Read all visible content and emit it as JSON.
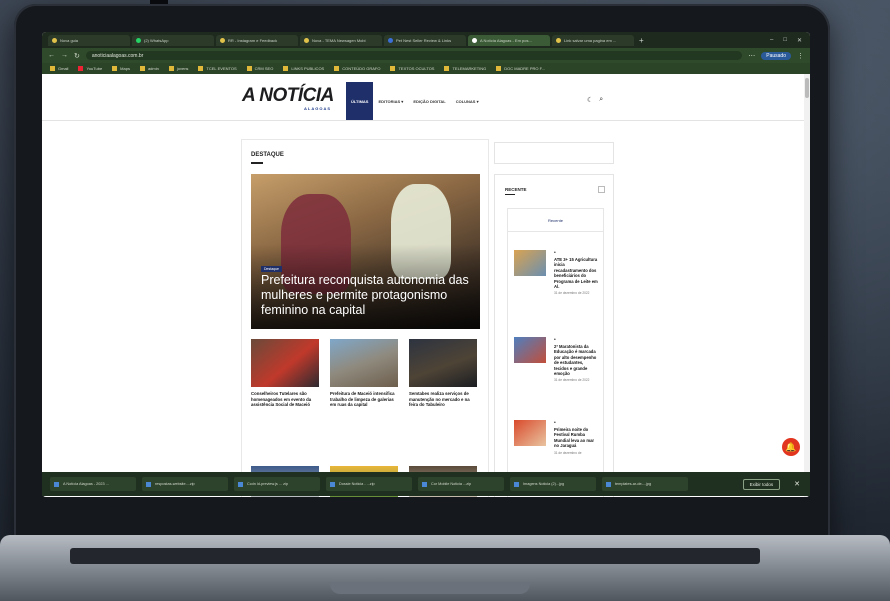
{
  "browser": {
    "tabs": [
      {
        "label": "Nova guia"
      },
      {
        "label": "(2) WhatsApp"
      },
      {
        "label": "RR - Instagram e Feedback"
      },
      {
        "label": "Nova - TEMA Newsagen Mobi"
      },
      {
        "label": "Pet Nest Seller Review & Links"
      },
      {
        "label": "A Notícia Alagoas - Em pos..."
      },
      {
        "label": "Link salvar uma pagina em ..."
      }
    ],
    "active_tab_index": 5,
    "url": "anoticiaalagoas.com.br",
    "profile_label": "Pausado",
    "bookmarks": [
      "Gmail",
      "YouTube",
      "Maps",
      "admin",
      "jovens",
      "TCEL EVENTOS",
      "CRM SEO",
      "LINKS PUBLICOS",
      "CONTEÚDO GRAFO",
      "TEXTOS OCULTOS",
      "TELEMARKETING",
      "DOC MADRE PRO F..."
    ]
  },
  "site": {
    "logo": "A NOTÍCIA",
    "logo_sub": "ALAGOAS",
    "menu": [
      "ÚLTIMAS",
      "EDITORIAS ▾",
      "EDIÇÃO DIGITAL",
      "COLUNAS ▾"
    ],
    "active_menu_index": 0,
    "header_icons": [
      "moon-icon",
      "search-icon"
    ]
  },
  "main": {
    "section_title": "DESTAQUE",
    "hero": {
      "badge": "Destaque",
      "title": "Prefeitura reconquista autonomia das mulheres e permite protagonismo feminino na capital"
    },
    "cards": [
      {
        "title": "Conselheiros Tutelares são homenageados em evento da assistência Social de Maceió"
      },
      {
        "title": "Prefeitura de Maceió intensifica trabalho de limpeza de galerias em ruas da capital"
      },
      {
        "title": "Semtabes realiza serviços de manutenção no mercado e na feira do Tabuleiro"
      }
    ]
  },
  "sidebar": {
    "title": "RECENTE",
    "tab_label": "Recente",
    "items": [
      {
        "text": "ATE 3+ 15 Agricultura inicia recadastramento dos beneficiários do Programa de Leite em Al.",
        "date": "31 de dezembro de 2022"
      },
      {
        "text": "2ª Maratonista da Educação é marcada por alto desempenho de estudantes, tecidos e grande emoção",
        "date": "31 de dezembro de 2022"
      },
      {
        "text": "Primeira noite do Festival Rumba Mundial leva ao mar no Jaraguá",
        "date": "31 de dezembro de"
      }
    ]
  },
  "taskbar": {
    "items": [
      "A Notícia Alagoas - 2023 ...",
      "respostas-website....zip",
      "Ccdn ld-preview.js ... zip",
      "Dossie Noticia - ...zip",
      "Cor Mobile Noticia ...zip",
      "Imagens Noticia (2)...jpg",
      "templates-ar-de-...jpg"
    ],
    "show_all_label": "Exibir todos"
  },
  "colors": {
    "brand_navy": "#1f2f6a",
    "browser_green": "#2f4a2b",
    "notification_red": "#e2351f"
  }
}
